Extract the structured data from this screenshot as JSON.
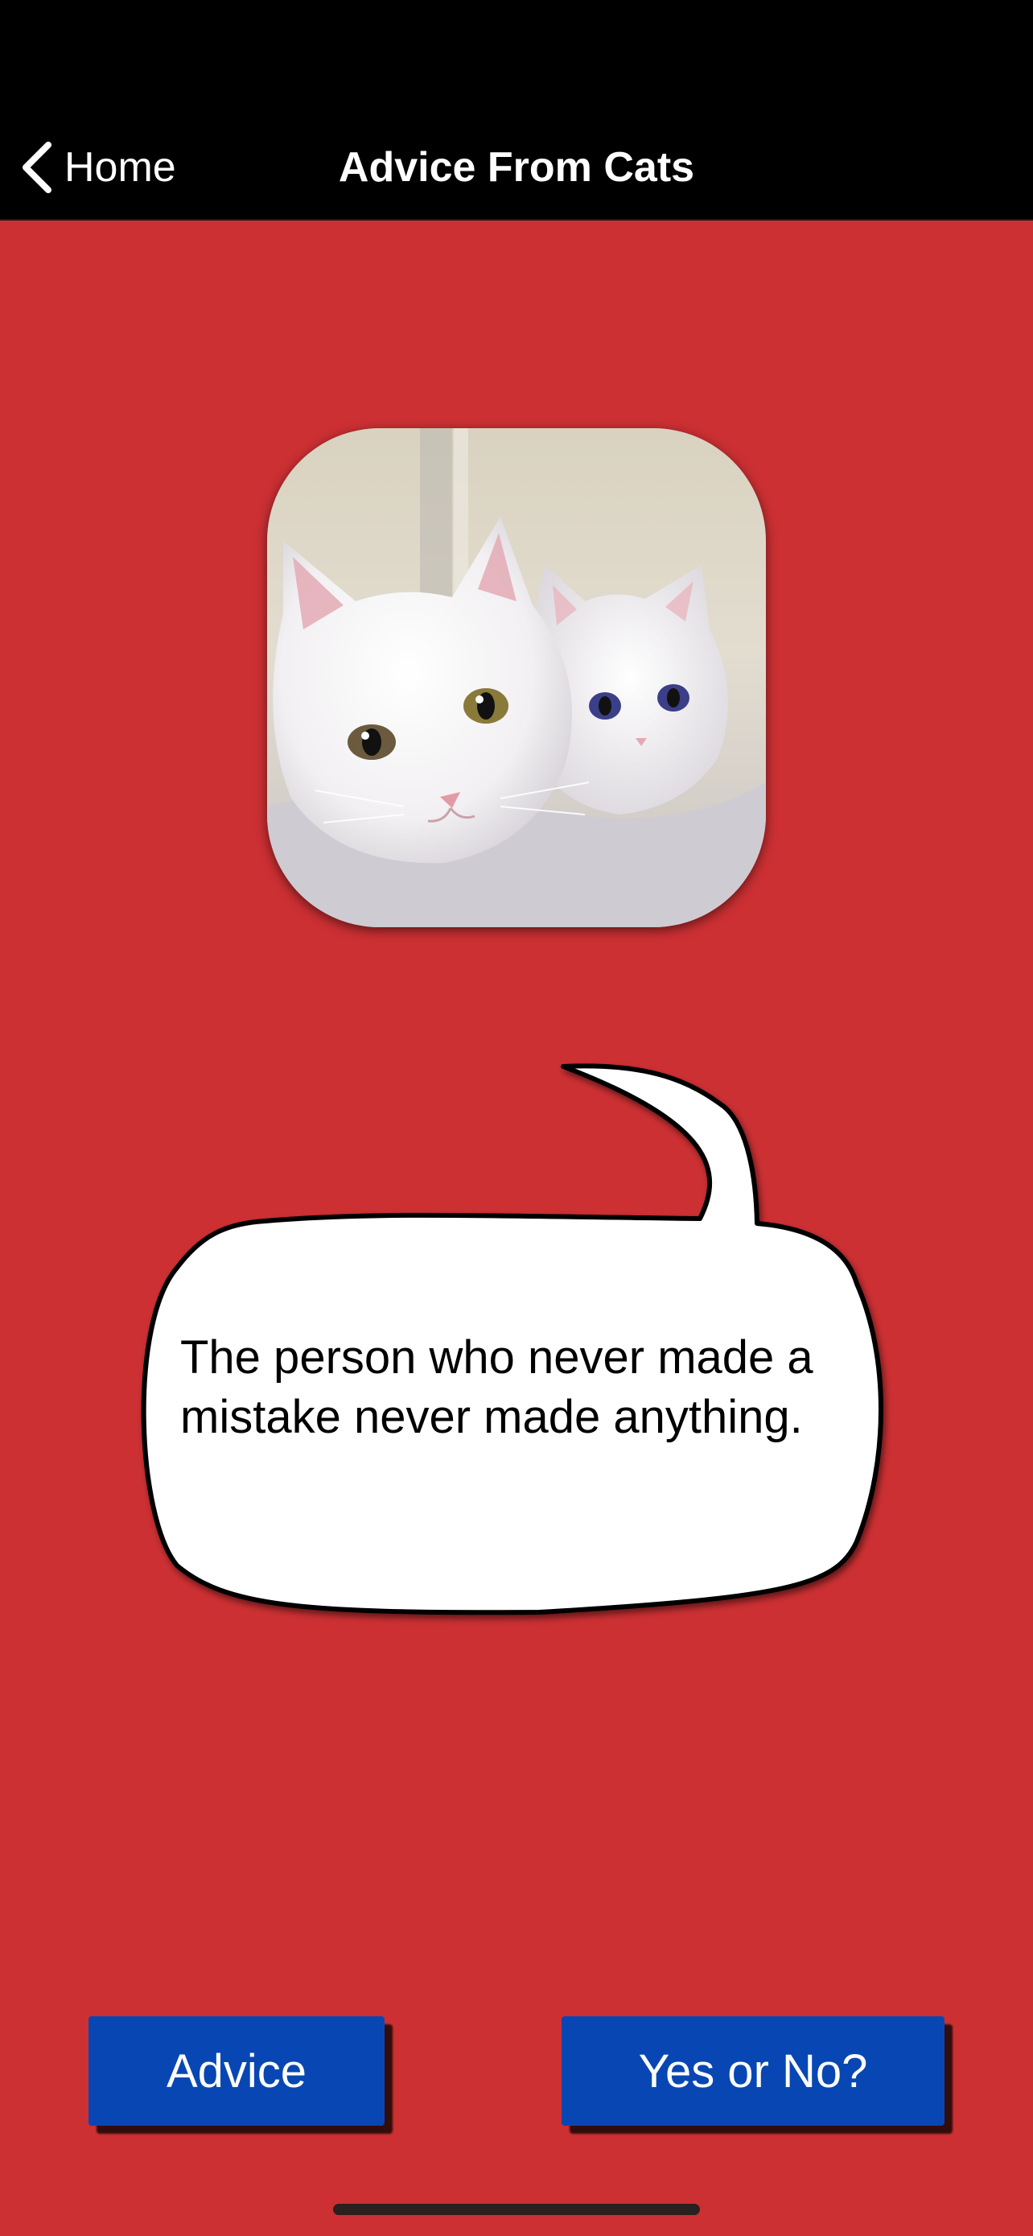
{
  "nav": {
    "back_label": "Home",
    "title": "Advice From Cats"
  },
  "image": {
    "subject": "two white cats"
  },
  "advice": {
    "quote": "The person who never made a mistake never made anything."
  },
  "buttons": {
    "advice_label": "Advice",
    "yes_no_label": "Yes or No?"
  },
  "colors": {
    "background": "#cc3033",
    "nav_background": "#000000",
    "button_background": "#0847b3",
    "button_text": "#ffffff"
  }
}
